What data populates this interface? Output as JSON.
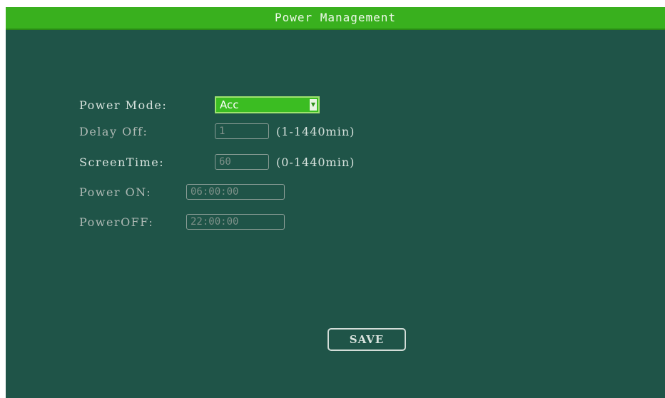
{
  "window": {
    "title": "Power Management"
  },
  "form": {
    "power_mode": {
      "label": "Power Mode:",
      "selected": "Acc",
      "arrow_icon": "dropdown-arrow"
    },
    "delay_off": {
      "label": "Delay  Off:",
      "value": "1",
      "range": "(1-1440min)"
    },
    "screen_time": {
      "label": "ScreenTime:",
      "value": "60",
      "range": "(0-1440min)"
    },
    "power_on": {
      "label": "Power ON:",
      "value": "06:00:00"
    },
    "power_off": {
      "label": "PowerOFF:",
      "value": "22:00:00"
    }
  },
  "actions": {
    "save_label": "SAVE"
  },
  "colors": {
    "background": "#1f5448",
    "title_bar": "#39b01e",
    "selected_combo": "#3bbd22"
  }
}
